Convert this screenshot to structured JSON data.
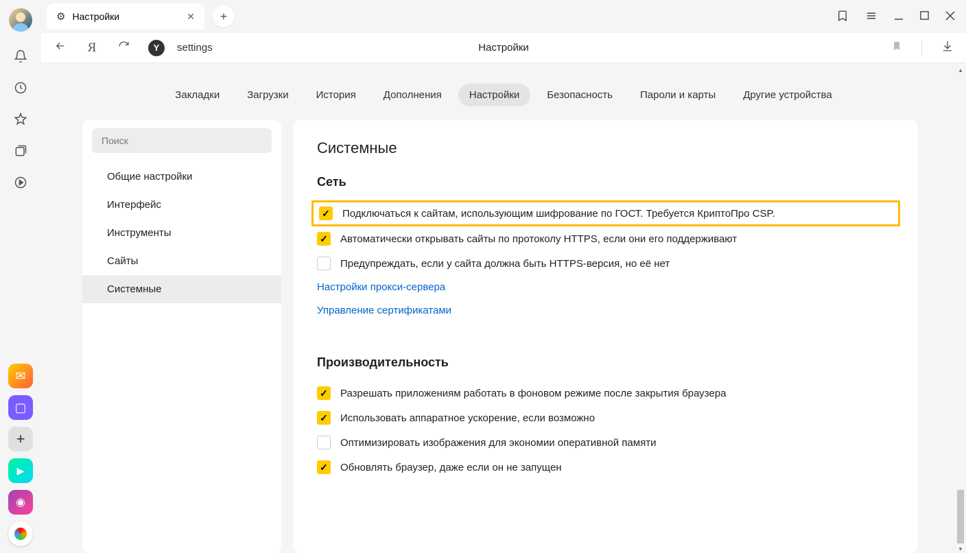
{
  "tab": {
    "title": "Настройки"
  },
  "url": {
    "site_letter": "Y",
    "text": "settings",
    "page_title": "Настройки"
  },
  "nav_tabs": [
    {
      "label": "Закладки",
      "key": "bookmarks"
    },
    {
      "label": "Загрузки",
      "key": "downloads"
    },
    {
      "label": "История",
      "key": "history"
    },
    {
      "label": "Дополнения",
      "key": "extensions"
    },
    {
      "label": "Настройки",
      "key": "settings",
      "active": true
    },
    {
      "label": "Безопасность",
      "key": "security"
    },
    {
      "label": "Пароли и карты",
      "key": "passwords"
    },
    {
      "label": "Другие устройства",
      "key": "devices"
    }
  ],
  "sidebar": {
    "search_placeholder": "Поиск",
    "items": [
      {
        "label": "Общие настройки",
        "key": "general"
      },
      {
        "label": "Интерфейс",
        "key": "interface"
      },
      {
        "label": "Инструменты",
        "key": "tools"
      },
      {
        "label": "Сайты",
        "key": "sites"
      },
      {
        "label": "Системные",
        "key": "system",
        "selected": true
      }
    ]
  },
  "page": {
    "title": "Системные",
    "sections": [
      {
        "heading": "Сеть",
        "key": "network",
        "items": [
          {
            "type": "checkbox",
            "checked": true,
            "highlighted": true,
            "key": "gost",
            "label": "Подключаться к сайтам, использующим шифрование по ГОСТ. Требуется КриптоПро CSP."
          },
          {
            "type": "checkbox",
            "checked": true,
            "key": "auto-https",
            "label": "Автоматически открывать сайты по протоколу HTTPS, если они его поддерживают"
          },
          {
            "type": "checkbox",
            "checked": false,
            "key": "warn-https",
            "label": "Предупреждать, если у сайта должна быть HTTPS-версия, но её нет"
          },
          {
            "type": "link",
            "key": "proxy",
            "label": "Настройки прокси-сервера"
          },
          {
            "type": "link",
            "key": "certs",
            "label": "Управление сертификатами"
          }
        ]
      },
      {
        "heading": "Производительность",
        "key": "performance",
        "items": [
          {
            "type": "checkbox",
            "checked": true,
            "key": "background",
            "label": "Разрешать приложениям работать в фоновом режиме после закрытия браузера"
          },
          {
            "type": "checkbox",
            "checked": true,
            "key": "hardware-accel",
            "label": "Использовать аппаратное ускорение, если возможно"
          },
          {
            "type": "checkbox",
            "checked": false,
            "key": "optimize-images",
            "label": "Оптимизировать изображения для экономии оперативной памяти"
          },
          {
            "type": "checkbox",
            "checked": true,
            "key": "auto-update",
            "label": "Обновлять браузер, даже если он не запущен"
          }
        ]
      }
    ]
  }
}
